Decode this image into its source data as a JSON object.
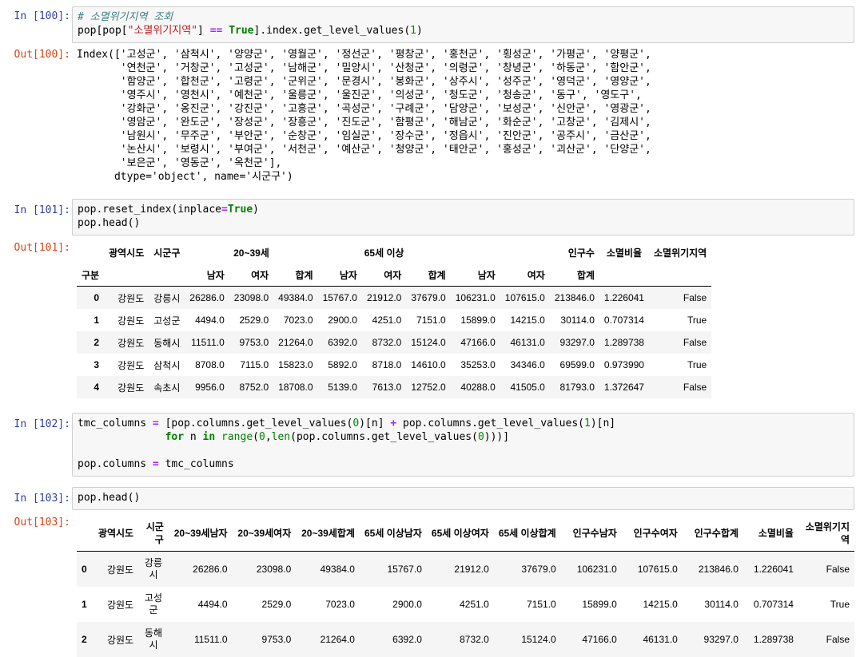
{
  "cells": {
    "c100": {
      "in_prompt": "In [100]:",
      "out_prompt": "Out[100]:",
      "line1_comment": "# 소멸위기지역 조회",
      "line2_a": "pop[pop[",
      "line2_str": "\"소멸위기지역\"",
      "line2_b": "] ",
      "line2_op": "==",
      "line2_c": " ",
      "line2_kw": "True",
      "line2_d": "].index.get_level_values(",
      "line2_num": "1",
      "line2_e": ")",
      "output_lines": [
        "Index(['고성군', '삼척시', '양양군', '영월군', '정선군', '평창군', '홍천군', '횡성군', '가평군', '양평군',",
        "       '연천군', '거창군', '고성군', '남해군', '밀양시', '산청군', '의령군', '창녕군', '하동군', '함안군',",
        "       '함양군', '합천군', '고령군', '군위군', '문경시', '봉화군', '상주시', '성주군', '영덕군', '영양군',",
        "       '영주시', '영천시', '예천군', '울릉군', '울진군', '의성군', '청도군', '청송군', '동구', '영도구',",
        "       '강화군', '옹진군', '강진군', '고흥군', '곡성군', '구례군', '담양군', '보성군', '신안군', '영광군',",
        "       '영암군', '완도군', '장성군', '장흥군', '진도군', '함평군', '해남군', '화순군', '고창군', '김제시',",
        "       '남원시', '무주군', '부안군', '순창군', '임실군', '장수군', '정읍시', '진안군', '공주시', '금산군',",
        "       '논산시', '보령시', '부여군', '서천군', '예산군', '청양군', '태안군', '홍성군', '괴산군', '단양군',",
        "       '보은군', '영동군', '옥천군'],",
        "      dtype='object', name='시군구')"
      ]
    },
    "c101": {
      "in_prompt": "In [101]:",
      "out_prompt": "Out[101]:",
      "l1_a": "pop.reset_index(inplace",
      "l1_op": "=",
      "l1_kw": "True",
      "l1_b": ")",
      "l2": "pop.head()",
      "table": {
        "top_headers": [
          "광역시도",
          "시군구",
          "20~39세",
          "65세 이상",
          "인구수",
          "소멸비율",
          "소멸위기지역"
        ],
        "sub_headers": [
          "남자",
          "여자",
          "합계",
          "남자",
          "여자",
          "합계",
          "남자",
          "여자",
          "합계"
        ],
        "index_name": "구분",
        "rows": [
          {
            "idx": "0",
            "cells": [
              "강원도",
              "강릉시",
              "26286.0",
              "23098.0",
              "49384.0",
              "15767.0",
              "21912.0",
              "37679.0",
              "106231.0",
              "107615.0",
              "213846.0",
              "1.226041",
              "False"
            ]
          },
          {
            "idx": "1",
            "cells": [
              "강원도",
              "고성군",
              "4494.0",
              "2529.0",
              "7023.0",
              "2900.0",
              "4251.0",
              "7151.0",
              "15899.0",
              "14215.0",
              "30114.0",
              "0.707314",
              "True"
            ]
          },
          {
            "idx": "2",
            "cells": [
              "강원도",
              "동해시",
              "11511.0",
              "9753.0",
              "21264.0",
              "6392.0",
              "8732.0",
              "15124.0",
              "47166.0",
              "46131.0",
              "93297.0",
              "1.289738",
              "False"
            ]
          },
          {
            "idx": "3",
            "cells": [
              "강원도",
              "삼척시",
              "8708.0",
              "7115.0",
              "15823.0",
              "5892.0",
              "8718.0",
              "14610.0",
              "35253.0",
              "34346.0",
              "69599.0",
              "0.973990",
              "True"
            ]
          },
          {
            "idx": "4",
            "cells": [
              "강원도",
              "속초시",
              "9956.0",
              "8752.0",
              "18708.0",
              "5139.0",
              "7613.0",
              "12752.0",
              "40288.0",
              "41505.0",
              "81793.0",
              "1.372647",
              "False"
            ]
          }
        ]
      }
    },
    "c102": {
      "in_prompt": "In [102]:",
      "l1_a": "tmc_columns ",
      "l1_op1": "=",
      "l1_b": " [pop.columns.get_level_values(",
      "l1_n0": "0",
      "l1_c": ")[n] ",
      "l1_op2": "+",
      "l1_d": " pop.columns.get_level_values(",
      "l1_n1": "1",
      "l1_e": ")[n]",
      "l2_indent": "              ",
      "l2_for": "for",
      "l2_a": " n ",
      "l2_in": "in",
      "l2_sp": " ",
      "l2_range": "range",
      "l2_b": "(",
      "l2_n0": "0",
      "l2_c": ",",
      "l2_len": "len",
      "l2_d": "(pop.columns.get_level_values(",
      "l2_n1": "0",
      "l2_e": ")))]",
      "l4_a": "pop.columns ",
      "l4_op": "=",
      "l4_b": " tmc_columns"
    },
    "c103": {
      "in_prompt": "In [103]:",
      "out_prompt": "Out[103]:",
      "code": "pop.head()",
      "table": {
        "headers": [
          "광역시도",
          "시군구",
          "20~39세남자",
          "20~39세여자",
          "20~39세합계",
          "65세 이상남자",
          "65세 이상여자",
          "65세 이상합계",
          "인구수남자",
          "인구수여자",
          "인구수합계",
          "소멸비율",
          "소멸위기지역"
        ],
        "rows": [
          {
            "idx": "0",
            "cells": [
              "강원도",
              "강릉시",
              "26286.0",
              "23098.0",
              "49384.0",
              "15767.0",
              "21912.0",
              "37679.0",
              "106231.0",
              "107615.0",
              "213846.0",
              "1.226041",
              "False"
            ]
          },
          {
            "idx": "1",
            "cells": [
              "강원도",
              "고성군",
              "4494.0",
              "2529.0",
              "7023.0",
              "2900.0",
              "4251.0",
              "7151.0",
              "15899.0",
              "14215.0",
              "30114.0",
              "0.707314",
              "True"
            ]
          },
          {
            "idx": "2",
            "cells": [
              "강원도",
              "동해시",
              "11511.0",
              "9753.0",
              "21264.0",
              "6392.0",
              "8732.0",
              "15124.0",
              "47166.0",
              "46131.0",
              "93297.0",
              "1.289738",
              "False"
            ]
          }
        ]
      }
    }
  }
}
